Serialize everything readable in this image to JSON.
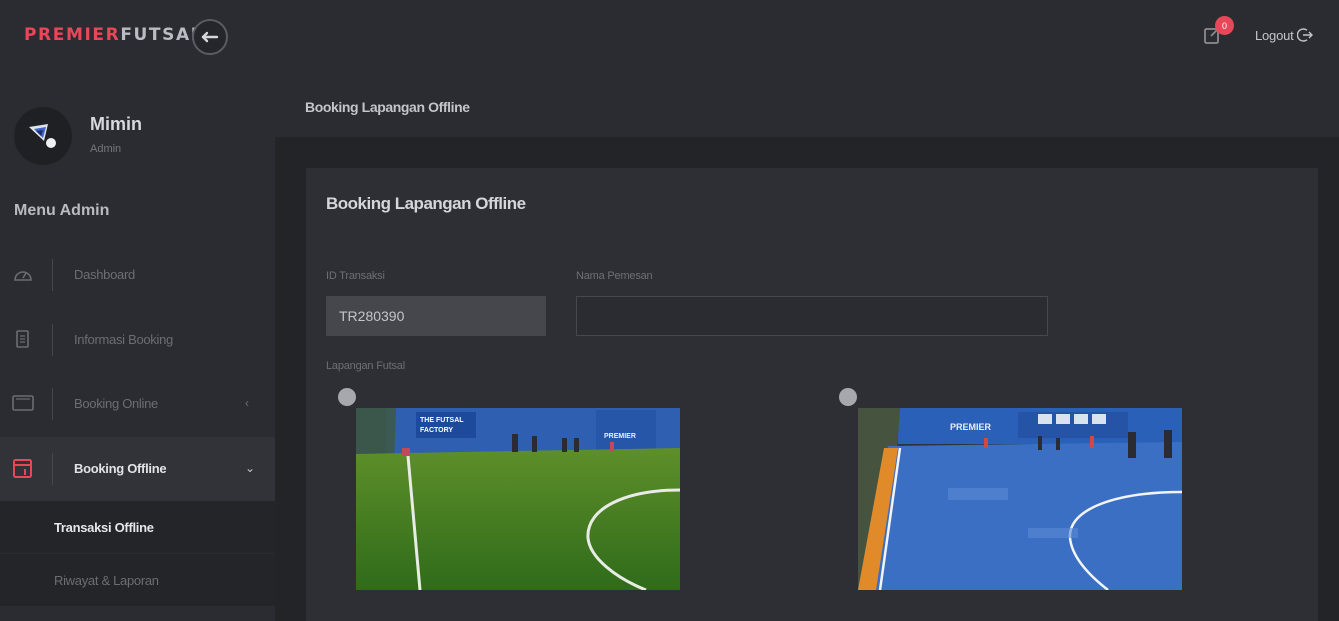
{
  "brand": {
    "part1": "PREMIER",
    "part2": "FUTSAL"
  },
  "header": {
    "back_icon": "arrow-left-icon",
    "notification_icon": "external-link-icon",
    "notification_count": "0",
    "logout_label": "Logout",
    "logout_icon": "logout-icon"
  },
  "profile": {
    "name": "Mimin",
    "role": "Admin"
  },
  "sidebar": {
    "menu_title": "Menu Admin",
    "items": [
      {
        "label": "Dashboard",
        "icon": "gauge-icon"
      },
      {
        "label": "Informasi Booking",
        "icon": "document-icon"
      },
      {
        "label": "Booking Online",
        "icon": "monitor-icon",
        "caret": "‹"
      },
      {
        "label": "Booking Offline",
        "icon": "calendar-icon",
        "caret": "⌄"
      }
    ],
    "subitems": [
      {
        "label": "Transaksi Offline"
      },
      {
        "label": "Riwayat & Laporan"
      }
    ]
  },
  "page": {
    "breadcrumb_title": "Booking Lapangan Offline"
  },
  "form": {
    "title": "Booking Lapangan Offline",
    "id_label": "ID Transaksi",
    "id_value": "TR280390",
    "name_label": "Nama Pemesan",
    "name_value": "",
    "court_label": "Lapangan Futsal",
    "courts": [
      {
        "type": "grass",
        "banner1": "THE FUTSAL",
        "banner2": "FACTORY",
        "banner3": "PREMIER"
      },
      {
        "type": "indoor",
        "banner1": "PREMIER"
      }
    ]
  },
  "colors": {
    "accent": "#e8475a",
    "brand_text": "#b9bcc2",
    "background": "#2b2c31",
    "card": "#2e2f34"
  }
}
